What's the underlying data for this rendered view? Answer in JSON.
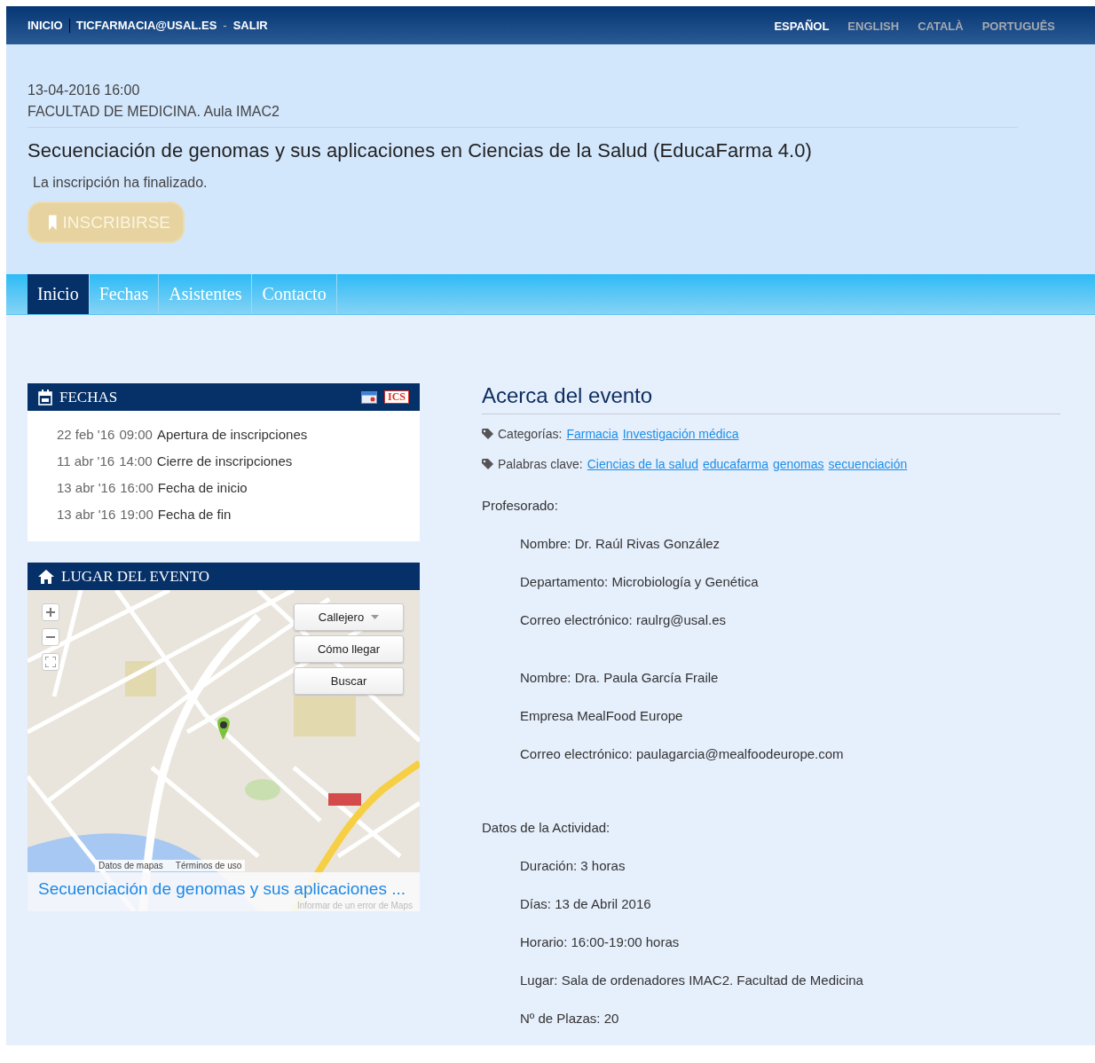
{
  "top_bar": {
    "user_nav": [
      {
        "kind": "link",
        "text": "INICIO"
      },
      {
        "kind": "rule"
      },
      {
        "kind": "link",
        "text": "TICFARMACIA@USAL.ES"
      },
      {
        "kind": "text",
        "text": "-"
      },
      {
        "kind": "link",
        "text": "SALIR"
      }
    ],
    "languages": [
      {
        "label": "ESPAÑOL",
        "selected": true
      },
      {
        "label": "ENGLISH",
        "selected": false
      },
      {
        "label": "CATALÀ",
        "selected": false
      },
      {
        "label": "PORTUGUÊS",
        "selected": false
      }
    ]
  },
  "event": {
    "datetime": "13-04-2016 16:00",
    "venue": "FACULTAD DE MEDICINA. Aula IMAC2",
    "title": "Secuenciación de genomas y sus aplicaciones en Ciencias de la Salud (EducaFarma 4.0)",
    "notice": "La inscripción ha finalizado.",
    "register_button": {
      "label": "INSCRIBIRSE",
      "disabled": true
    }
  },
  "tabs": [
    {
      "label": "Inicio",
      "selected": true
    },
    {
      "label": "Fechas",
      "selected": false
    },
    {
      "label": "Asistentes",
      "selected": false
    },
    {
      "label": "Contacto",
      "selected": false
    }
  ],
  "dates_panel": {
    "title": "FECHAS",
    "export_label": "ICS",
    "rows": [
      {
        "date": "22 feb '16",
        "time": "09:00",
        "label": "Apertura de inscripciones"
      },
      {
        "date": "11 abr '16",
        "time": "14:00",
        "label": "Cierre de inscripciones"
      },
      {
        "date": "13 abr '16",
        "time": "16:00",
        "label": "Fecha de inicio"
      },
      {
        "date": "13 abr '16",
        "time": "19:00",
        "label": "Fecha de fin"
      }
    ]
  },
  "venue_panel": {
    "title": "LUGAR DEL EVENTO",
    "map": {
      "controls": [
        {
          "label": "Callejero",
          "dropdown": true
        },
        {
          "label": "Cómo llegar",
          "dropdown": false
        },
        {
          "label": "Buscar",
          "dropdown": false
        }
      ],
      "attribution": [
        "Datos de mapas",
        "Términos de uso"
      ],
      "caption": "Secuenciación de genomas y sus aplicaciones ...",
      "report": "Informar de un error de Maps"
    }
  },
  "about": {
    "title": "Acerca del evento",
    "tag_rows": [
      {
        "label": "Categorías:",
        "links": [
          "Farmacia",
          "Investigación médica"
        ]
      },
      {
        "label": "Palabras clave:",
        "links": [
          "Ciencias de la salud",
          "educafarma",
          "genomas",
          "secuenciación"
        ]
      }
    ],
    "sections": [
      {
        "heading": "Profesorado:",
        "groups": [
          [
            "Nombre: Dr. Raúl Rivas González",
            "Departamento: Microbiología y Genética",
            "Correo electrónico: raulrg@usal.es"
          ],
          [
            "Nombre: Dra. Paula García Fraile",
            "Empresa MealFood Europe",
            "Correo electrónico: paulagarcia@mealfoodeurope.com"
          ]
        ]
      },
      {
        "heading": "Datos de la Actividad:",
        "groups": [
          [
            "Duración: 3 horas",
            "Días: 13 de Abril 2016",
            "Horario: 16:00-19:00 horas",
            "Lugar: Sala de ordenadores IMAC2. Facultad de Medicina",
            "Nº de Plazas: 20"
          ]
        ]
      }
    ]
  }
}
